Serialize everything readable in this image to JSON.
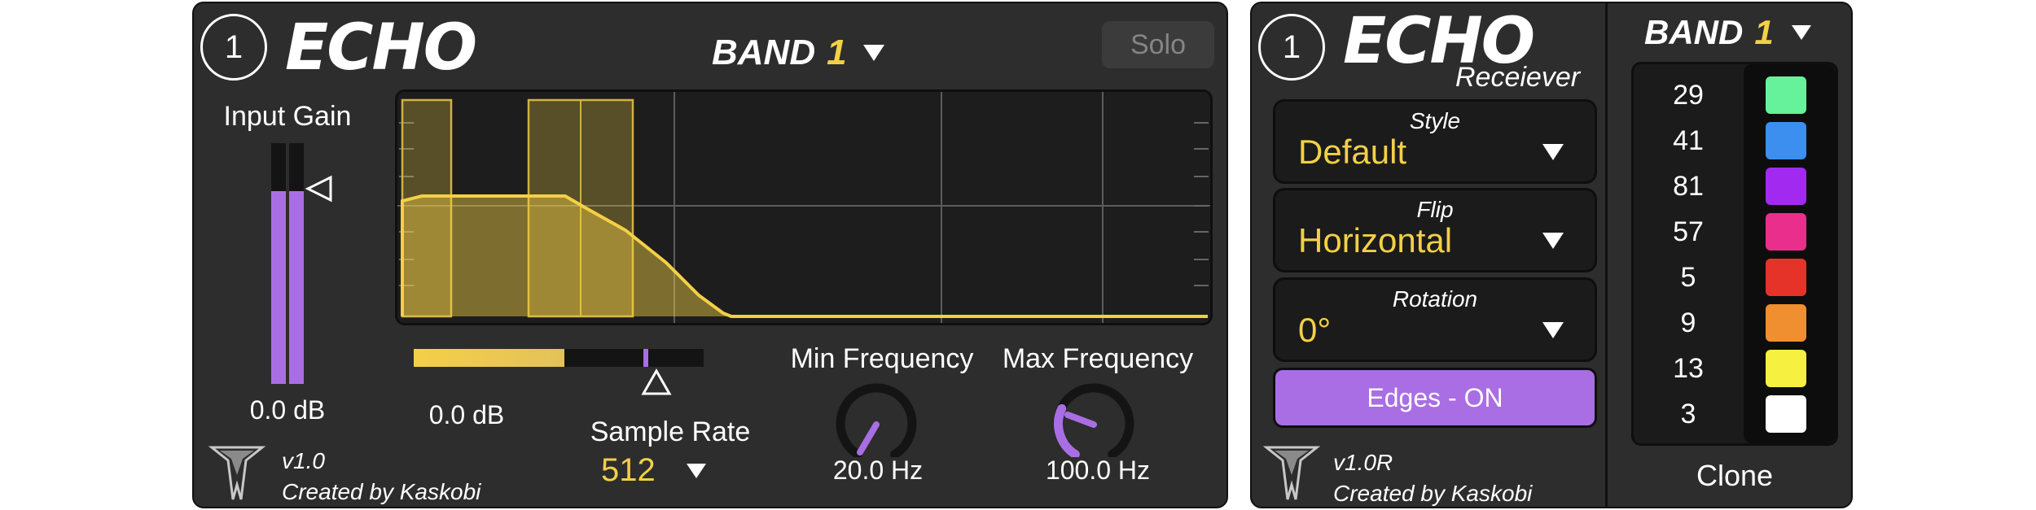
{
  "echo": {
    "channel": "1",
    "logo": "ECHO",
    "band_label": "BAND",
    "band_number": "1",
    "solo_label": "Solo",
    "input_gain": {
      "label": "Input Gain",
      "value_text": "0.0 dB",
      "level": 0.8
    },
    "threshold": {
      "value_text": "0.0 dB",
      "level": 0.52
    },
    "sample_rate": {
      "label": "Sample Rate",
      "value": "512"
    },
    "min_frequency": {
      "label": "Min Frequency",
      "value_text": "20.0 Hz"
    },
    "max_frequency": {
      "label": "Max Frequency",
      "value_text": "100.0 Hz"
    },
    "version": "v1.0",
    "credit": "Created by Kaskobi"
  },
  "receiver": {
    "channel": "1",
    "logo": "ECHO",
    "subtitle": "Receiever",
    "style": {
      "caption": "Style",
      "value": "Default"
    },
    "flip": {
      "caption": "Flip",
      "value": "Horizontal"
    },
    "rotation": {
      "caption": "Rotation",
      "value": "0°"
    },
    "edges_button": "Edges - ON",
    "version": "v1.0R",
    "credit": "Created by Kaskobi",
    "band_label": "BAND",
    "band_number": "1",
    "clones": [
      {
        "number": "29",
        "color": "#66f29a"
      },
      {
        "number": "41",
        "color": "#3c8fef"
      },
      {
        "number": "81",
        "color": "#a22af0"
      },
      {
        "number": "57",
        "color": "#ea2e8c"
      },
      {
        "number": "5",
        "color": "#e5332a"
      },
      {
        "number": "9",
        "color": "#ef8f2f"
      },
      {
        "number": "13",
        "color": "#f6f040"
      },
      {
        "number": "3",
        "color": "#ffffff"
      }
    ],
    "clone_label": "Clone"
  },
  "colors": {
    "accent_yellow": "#f3d046",
    "accent_purple": "#a96ee3",
    "panel": "#2d2d2d"
  }
}
